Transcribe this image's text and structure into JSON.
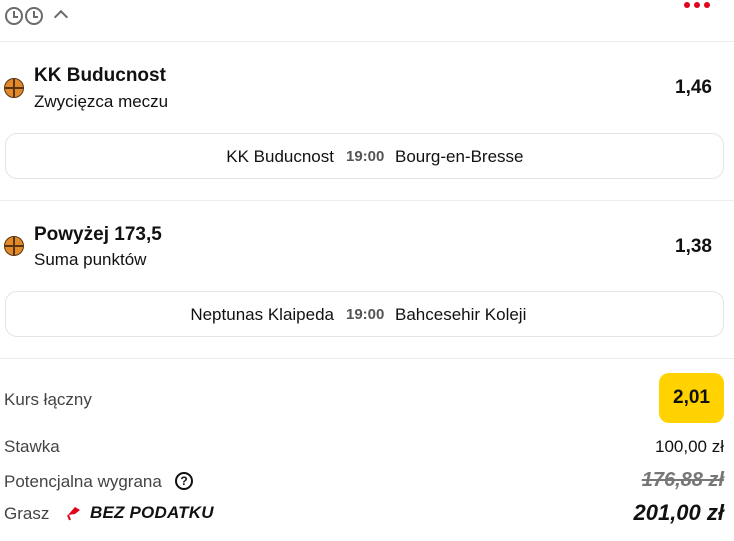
{
  "header": {
    "icons": [
      "clock-icon",
      "clock-icon",
      "chevron-up-icon",
      "more-dots-icon"
    ],
    "accent_color": "#e2001a"
  },
  "bets": [
    {
      "sport_icon": "basketball-icon",
      "selection": "KK Buducnost",
      "market": "Zwycięzca meczu",
      "odds": "1,46",
      "match": {
        "home": "KK Buducnost",
        "time": "19:00",
        "away": "Bourg-en-Bresse"
      }
    },
    {
      "sport_icon": "basketball-icon",
      "selection": "Powyżej 173,5",
      "market": "Suma punktów",
      "odds": "1,38",
      "match": {
        "home": "Neptunas Klaipeda",
        "time": "19:00",
        "away": "Bahcesehir Koleji"
      }
    }
  ],
  "summary": {
    "total_odds_label": "Kurs łączny",
    "total_odds": "2,01",
    "total_odds_color": "#ffd200",
    "stake_label": "Stawka",
    "stake_value": "100,00 zł",
    "potential_win_label": "Potencjalna wygrana",
    "potential_win_old": "176,88 zł",
    "play_label": "Grasz",
    "tax_badge": "BEZ PODATKU",
    "potential_win_new": "201,00 zł"
  }
}
